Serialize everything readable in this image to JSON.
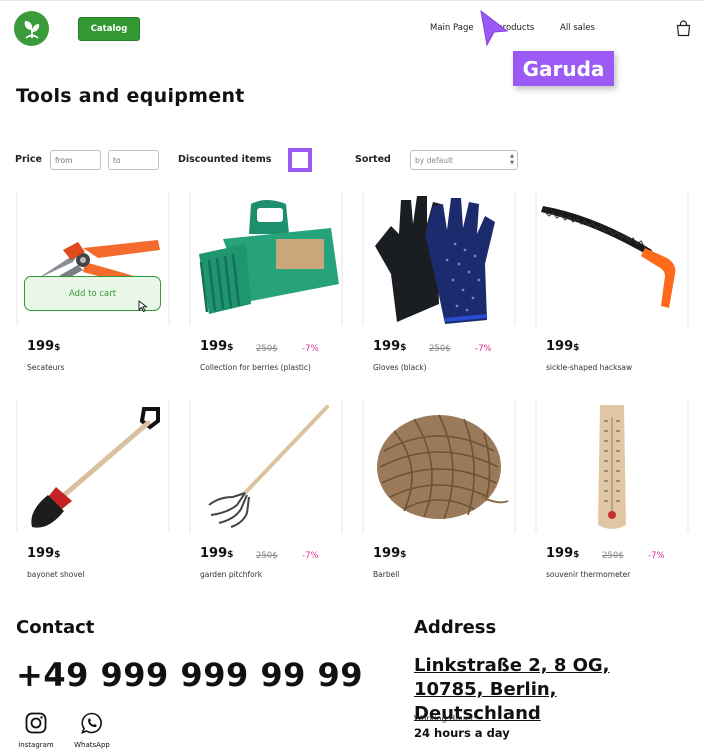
{
  "header": {
    "catalog_label": "Catalog",
    "nav": [
      "Main Page",
      "All products",
      "All sales"
    ],
    "accent": "#339933"
  },
  "overlay": {
    "tooltip_label": "Garuda",
    "color": "#9b59f5"
  },
  "page": {
    "title": "Tools and equipment"
  },
  "filters": {
    "price_label": "Price",
    "from_placeholder": "from",
    "to_placeholder": "to",
    "discount_label": "Discounted items",
    "sort_label": "Sorted",
    "sort_value": "by default"
  },
  "products": [
    {
      "price": "199",
      "currency": "$",
      "old_price": "",
      "discount": "",
      "name": "Secateurs",
      "action": "Add to cart"
    },
    {
      "price": "199",
      "currency": "$",
      "old_price": "250$",
      "discount": "-7%",
      "name": "Collection for berries (plastic)"
    },
    {
      "price": "199",
      "currency": "$",
      "old_price": "250$",
      "discount": "-7%",
      "name": "Gloves (black)"
    },
    {
      "price": "199",
      "currency": "$",
      "old_price": "",
      "discount": "",
      "name": "sickle-shaped hacksaw"
    },
    {
      "price": "199",
      "currency": "$",
      "old_price": "",
      "discount": "",
      "name": "bayonet shovel"
    },
    {
      "price": "199",
      "currency": "$",
      "old_price": "250$",
      "discount": "-7%",
      "name": "garden pitchfork"
    },
    {
      "price": "199",
      "currency": "$",
      "old_price": "",
      "discount": "",
      "name": "Barbell"
    },
    {
      "price": "199",
      "currency": "$",
      "old_price": "250$",
      "discount": "-7%",
      "name": "souvenir thermometer"
    }
  ],
  "footer": {
    "contact_title": "Contact",
    "phone": "+49 999 999 99 99",
    "socials": [
      "instagram",
      "WhatsApp"
    ],
    "address_title": "Address",
    "address": "Linkstraße 2, 8 OG, 10785, Berlin, Deutschland",
    "working_hours_label": "Working Hours:",
    "working_hours_value": "24 hours a day"
  }
}
